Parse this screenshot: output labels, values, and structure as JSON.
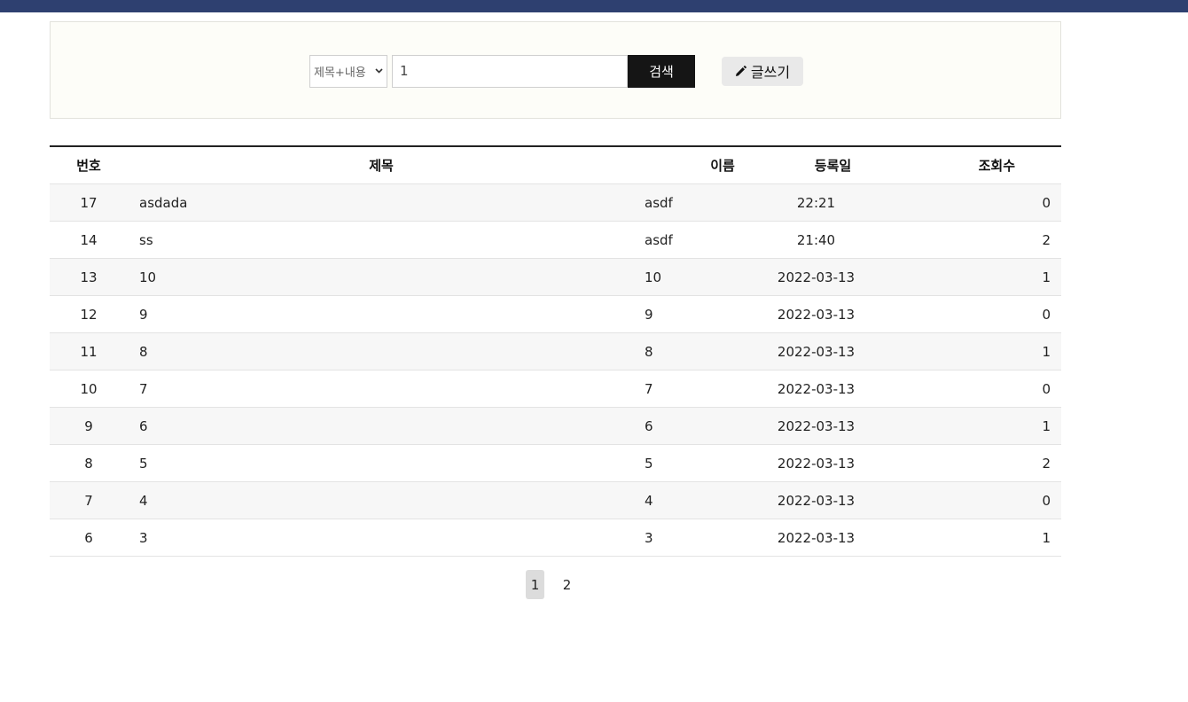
{
  "search": {
    "field_option": "제목+내용",
    "keyword": "1",
    "button_label": "검색",
    "write_label": "글쓰기"
  },
  "table": {
    "headers": {
      "no": "번호",
      "title": "제목",
      "name": "이름",
      "date": "등록일",
      "views": "조회수"
    },
    "rows": [
      {
        "no": "17",
        "title": "asdada",
        "name": "asdf",
        "date": "22:21",
        "views": "0"
      },
      {
        "no": "14",
        "title": "ss",
        "name": "asdf",
        "date": "21:40",
        "views": "2"
      },
      {
        "no": "13",
        "title": "10",
        "name": "10",
        "date": "2022-03-13",
        "views": "1"
      },
      {
        "no": "12",
        "title": "9",
        "name": "9",
        "date": "2022-03-13",
        "views": "0"
      },
      {
        "no": "11",
        "title": "8",
        "name": "8",
        "date": "2022-03-13",
        "views": "1"
      },
      {
        "no": "10",
        "title": "7",
        "name": "7",
        "date": "2022-03-13",
        "views": "0"
      },
      {
        "no": "9",
        "title": "6",
        "name": "6",
        "date": "2022-03-13",
        "views": "1"
      },
      {
        "no": "8",
        "title": "5",
        "name": "5",
        "date": "2022-03-13",
        "views": "2"
      },
      {
        "no": "7",
        "title": "4",
        "name": "4",
        "date": "2022-03-13",
        "views": "0"
      },
      {
        "no": "6",
        "title": "3",
        "name": "3",
        "date": "2022-03-13",
        "views": "1"
      }
    ]
  },
  "pagination": {
    "pages": [
      "1",
      "2"
    ],
    "current": "1"
  },
  "colors": {
    "topbar": "#2e4070",
    "search_button": "#151515"
  }
}
